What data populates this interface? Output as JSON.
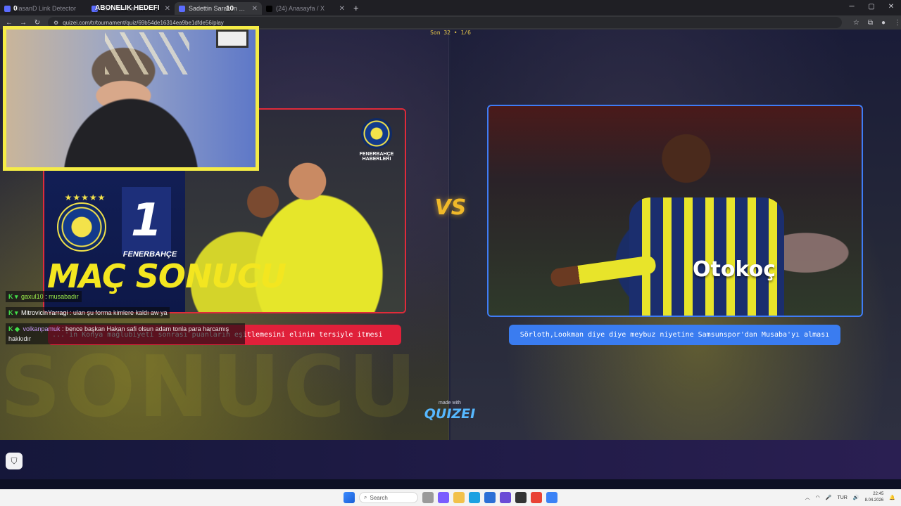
{
  "browser": {
    "tabs": [
      {
        "title": "HasanD Link Detector",
        "active": false
      },
      {
        "title": "Sadettin Saran'ın Büyük Proj...",
        "active": false
      },
      {
        "title": "Sadettin Saran'ın büyük pro...",
        "active": true
      },
      {
        "title": "(24) Anasayfa / X",
        "active": false
      }
    ],
    "new_tab": "+",
    "url": "quizei.com/tr/tournament/quiz/69b54de16314ea9be1dfde56/play"
  },
  "overlay": {
    "subscriber_goal": "ABONELIK HEDEFI",
    "counter_left": "0",
    "counter_right": "10"
  },
  "quiz": {
    "progress": "Son 32 • 1/6",
    "vs": "VS",
    "left_option": "...'in Konya mağlubiyeti sonrası puanların eşitlemesini elinin tersiyle itmesi",
    "right_option": "Sörloth,Lookman diye diye meybuz niyetine Samsunspor'dan Musaba'yı alması",
    "made_with": "made with",
    "brand": "QUIZEI"
  },
  "left_image": {
    "score": "1",
    "team": "FENERBAHÇE",
    "headline": "MAÇ SONUCU",
    "source": "FENERBAHÇE HABERLERI",
    "stars": "★★★★★"
  },
  "right_image": {
    "sponsor": "Otokoç"
  },
  "background": {
    "watermark": "SONUCU"
  },
  "chat": [
    {
      "user": "gaxul10",
      "message": "musabadır",
      "user_color": "green",
      "message_color": "green"
    },
    {
      "user": "MitrovicinYarragi",
      "message": "ulan şu forma kimlere kaldı aw ya",
      "user_color": "white",
      "message_color": "white"
    },
    {
      "user": "volkanpamuk",
      "message": "bence başkan Hakan safi olsun adam tonla para harcamış hakkıdır",
      "user_color": "violet",
      "message_color": "violet"
    }
  ],
  "taskbar": {
    "search_placeholder": "Search",
    "lang": "TUR",
    "time": "22:45",
    "date": "8.04.2026"
  },
  "colors": {
    "left_accent": "#e0203a",
    "right_accent": "#3a7cf0",
    "overlay_yellow": "#f5ec46",
    "progress_text": "#e7c84a"
  }
}
